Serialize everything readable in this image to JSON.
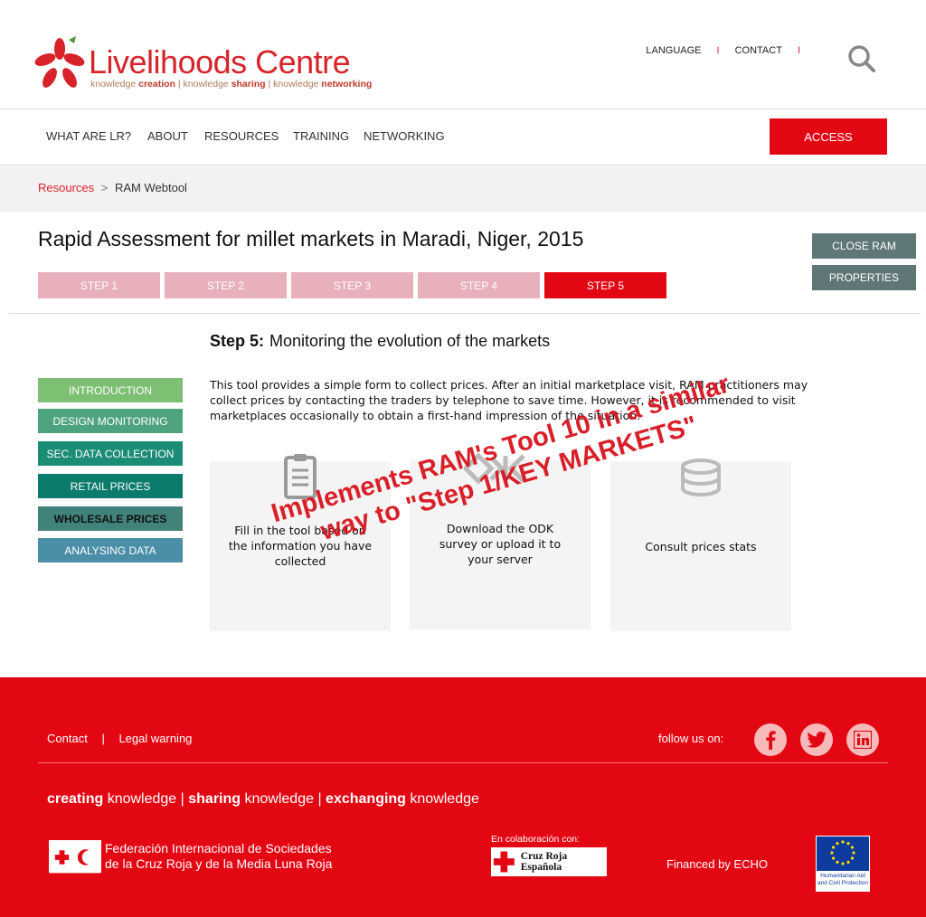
{
  "header": {
    "logo": {
      "title_bold": "Live",
      "title_thin": "lihoods Centre",
      "sub": [
        {
          "plain": "knowledge ",
          "bold": "creation"
        },
        {
          "plain": " | knowledge ",
          "bold": "sharing"
        },
        {
          "plain": " | knowledge ",
          "bold": "networking"
        }
      ]
    },
    "topnav": {
      "language": "LANGUAGE",
      "separator": "I",
      "contact": "CONTACT"
    },
    "search_icon": "search-icon"
  },
  "mainnav": {
    "items": [
      "WHAT ARE LR?",
      "ABOUT",
      "RESOURCES",
      "TRAINING",
      "NETWORKING"
    ],
    "access": "ACCESS"
  },
  "breadcrumb": {
    "link": "Resources",
    "sep": ">",
    "current": "RAM Webtool"
  },
  "page": {
    "title": "Rapid Assessment for millet markets in Maradi, Niger, 2015",
    "steps": [
      {
        "label": "STEP 1",
        "active": false
      },
      {
        "label": "STEP 2",
        "active": false
      },
      {
        "label": "STEP 3",
        "active": false
      },
      {
        "label": "STEP 4",
        "active": false
      },
      {
        "label": "STEP 5",
        "active": true
      }
    ],
    "close_ram": "CLOSE RAM",
    "properties": "PROPERTIES"
  },
  "left_menu": [
    {
      "label": "INTRODUCTION",
      "color": "#7dbf73"
    },
    {
      "label": "DESIGN MONITORING",
      "color": "#4ea37f"
    },
    {
      "label": "SEC. DATA COLLECTION",
      "color": "#1b8c75"
    },
    {
      "label": "RETAIL PRICES",
      "color": "#0b7b6b"
    },
    {
      "label": "WHOLESALE PRICES",
      "color": "#41827a"
    },
    {
      "label": "ANALYSING DATA",
      "color": "#4a8ea8"
    }
  ],
  "content": {
    "step_label": "Step 5:",
    "step_title": "Monitoring the evolution of the markets",
    "intro": "This tool provides a simple form to collect prices. After an initial marketplace visit, RAM practitioners may collect prices by contacting the traders by telephone to save time. However, it is recommended to visit marketplaces occasionally to obtain a first-hand impression of the situation.",
    "cards": [
      {
        "icon": "clipboard-icon",
        "text": "Fill in the tool based on the information you have collected"
      },
      {
        "icon": "odk-logo-icon",
        "text": "Download the ODK survey or upload it to your server"
      },
      {
        "icon": "database-icon",
        "text": "Consult prices stats"
      }
    ],
    "overlay": "Implements RAM's Tool 10 in a similar way to \"Step 1/KEY MARKETS\""
  },
  "footer": {
    "contact": "Contact",
    "sep": "|",
    "legal": "Legal warning",
    "follow": "follow us on:",
    "social": [
      "facebook-icon",
      "twitter-icon",
      "linkedin-icon"
    ],
    "tagline": [
      {
        "bold": "creating",
        "plain": " knowledge"
      },
      {
        "bold": "sharing",
        "plain": " knowledge"
      },
      {
        "bold": "exchanging",
        "plain": " knowledge"
      }
    ],
    "tagline_sep": " | ",
    "ifrc_line1": "Federación Internacional de Sociedades",
    "ifrc_line2": "de la Cruz Roja y de la Media Luna Roja",
    "colab": "En colaboración con:",
    "cruz_roja": "Cruz Roja Española",
    "echo": "Financed by ECHO",
    "eu_text": "Humanitarian Aid and Civil Protection"
  }
}
